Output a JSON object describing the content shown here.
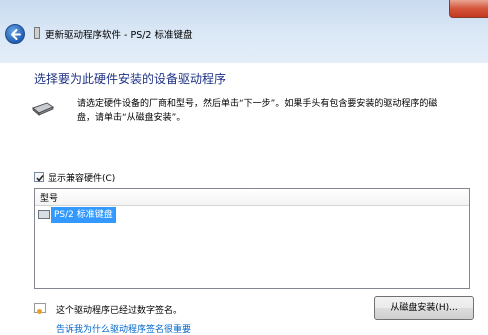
{
  "window": {
    "title": "更新驱动程序软件 - PS/2 标准键盘"
  },
  "main": {
    "heading": "选择要为此硬件安装的设备驱动程序",
    "instruction_line1": "请选定硬件设备的厂商和型号，然后单击“下一步”。如果手头有包含要安装的驱动程序的磁",
    "instruction_line2": "盘，请单击“从磁盘安装”。",
    "show_compatible_label": "显示兼容硬件(C)",
    "show_compatible_checked": true,
    "list": {
      "column_header": "型号",
      "items": [
        {
          "label": "PS/2 标准键盘",
          "selected": true
        }
      ]
    },
    "signature_text": "这个驱动程序已经过数字签名。",
    "have_disk_button": "从磁盘安装(H)...",
    "why_signing_link": "告诉我为什么驱动程序签名很重要"
  },
  "colors": {
    "heading": "#1e3287",
    "selection": "#3399ff",
    "link": "#0066cc"
  }
}
